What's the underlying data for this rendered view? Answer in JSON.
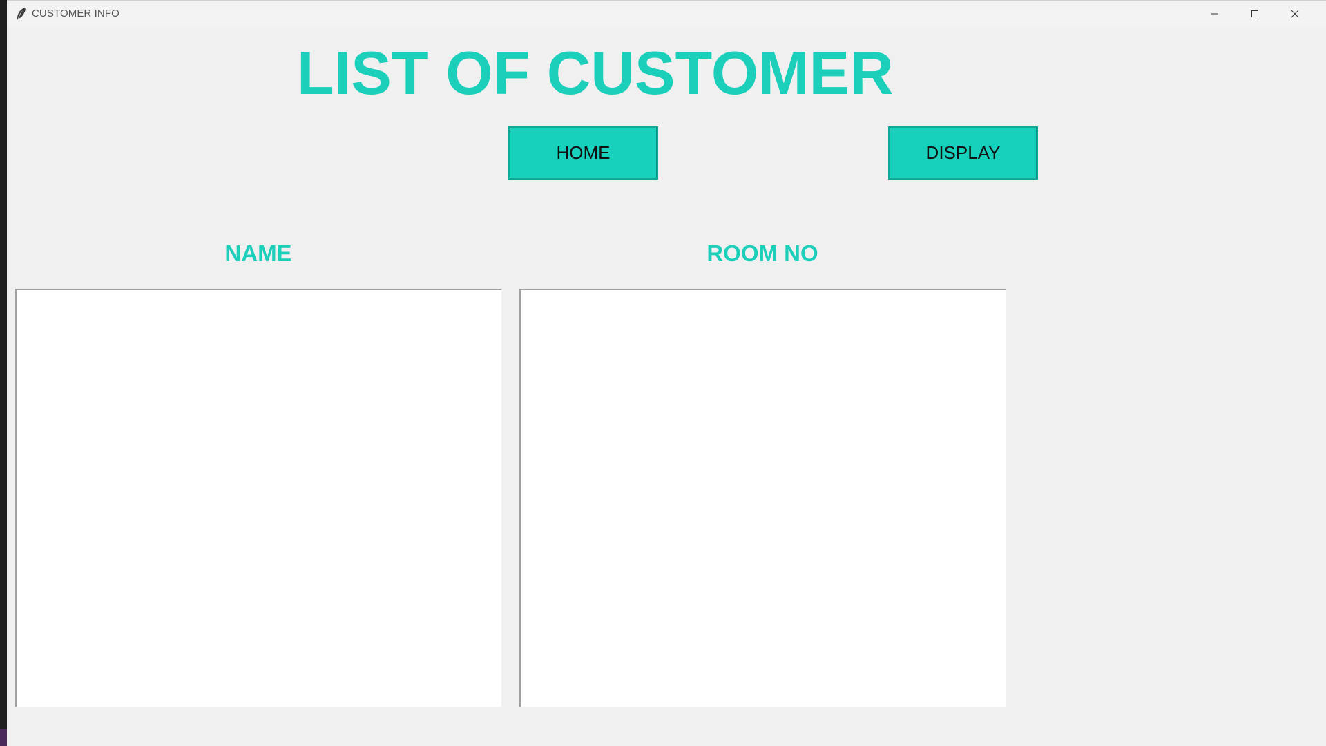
{
  "window": {
    "title": "CUSTOMER INFO",
    "app_icon": "feather-icon",
    "controls": [
      "minimize-icon",
      "maximize-icon",
      "close-icon"
    ]
  },
  "heading": "LIST OF CUSTOMER",
  "buttons": {
    "home_label": "HOME",
    "display_label": "DISPLAY"
  },
  "columns": {
    "name_header": "NAME",
    "room_header": "ROOM NO"
  },
  "lists": {
    "names": [],
    "rooms": []
  },
  "colors": {
    "accent": "#1ccfbb",
    "button_bg": "#17d1bd",
    "window_bg": "#f0f0f0",
    "list_bg": "#ffffff"
  }
}
